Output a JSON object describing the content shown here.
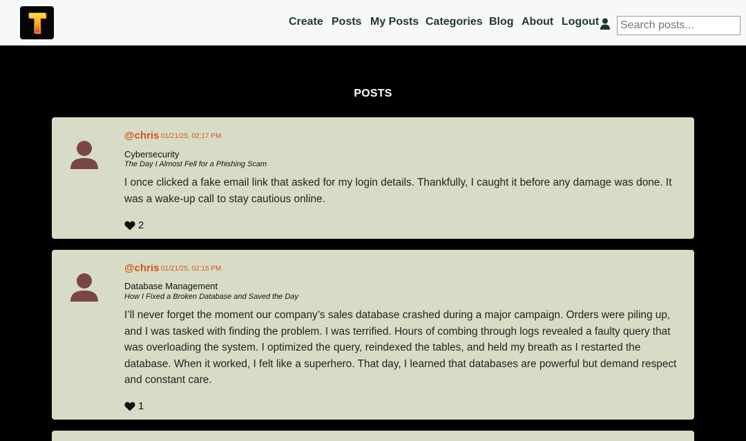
{
  "nav": {
    "logo_letter": "T",
    "links": [
      "Create",
      "Posts",
      "My Posts",
      "Categories",
      "Blog",
      "About",
      "Logout"
    ],
    "search_placeholder": "Search posts..."
  },
  "page": {
    "title": "POSTS"
  },
  "posts": [
    {
      "handle": "@chris",
      "timestamp": "01/21/25, 02:17 PM",
      "category": "Cybersecurity",
      "title": "The Day I Almost Fell for a Phishing Scam",
      "body": "I once clicked a fake email link that asked for my login details. Thankfully, I caught it before any damage was done. It was a wake-up call to stay cautious online.",
      "likes": "2"
    },
    {
      "handle": "@chris",
      "timestamp": "01/21/25, 02:15 PM",
      "category": "Database Management",
      "title": "How I Fixed a Broken Database and Saved the Day",
      "body": "I’ll never forget the moment our company’s sales database crashed during a major campaign. Orders were piling up, and I was tasked with finding the problem. I was terrified. Hours of combing through logs revealed a faulty query that was overloading the system. I optimized the query, reindexed the tables, and held my breath as I restarted the database. When it worked, I felt like a superhero. That day, I learned that databases are powerful but demand respect and constant care.",
      "likes": "1"
    }
  ],
  "colors": {
    "nav_bg": "#f7f8f9",
    "nav_text": "#1d3a2c",
    "page_bg": "#000000",
    "card_bg": "#d8dcc6",
    "accent": "#d4541a",
    "avatar": "#7a4744",
    "logo_gradient": [
      "#ffe13a",
      "#f29a18",
      "#e0402a"
    ]
  },
  "icons": [
    "user-icon",
    "heart-icon",
    "avatar-person-icon",
    "logo-t-icon"
  ]
}
